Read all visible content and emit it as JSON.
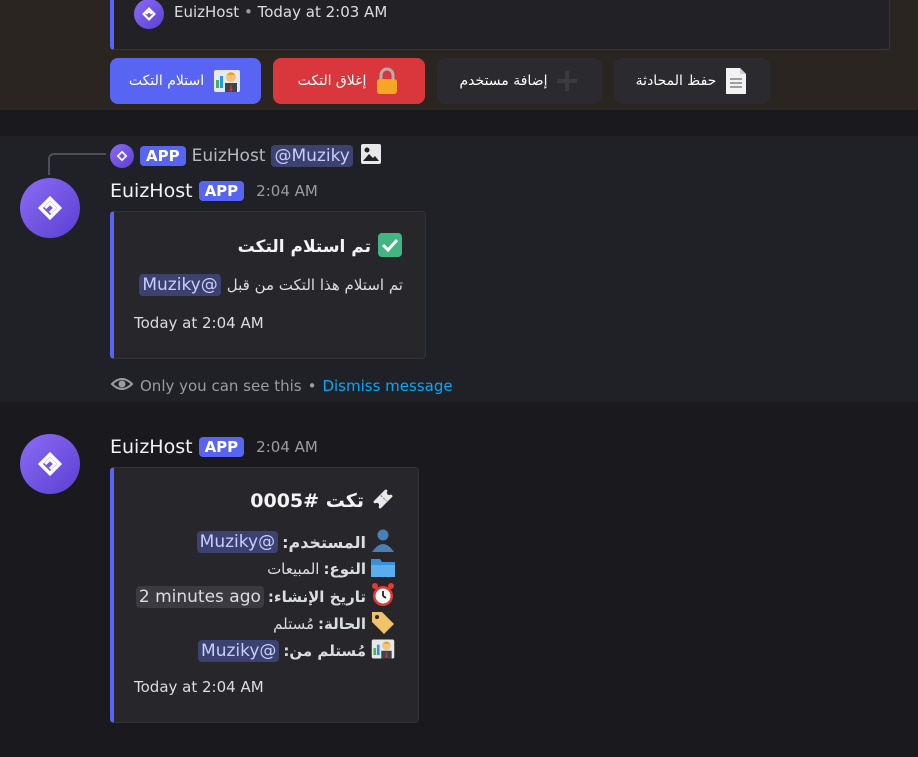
{
  "top": {
    "author": "EuizHost",
    "timestamp": "Today at 2:03 AM",
    "buttons": [
      {
        "label": "استلام التكت",
        "icon": "manager-emoji-icon",
        "color": "#5865f2"
      },
      {
        "label": "إغلاق التكت",
        "icon": "lock-icon",
        "color": "#da373c"
      },
      {
        "label": "إضافة مستخدم",
        "icon": "plus-icon",
        "color": "#2b2a2e"
      },
      {
        "label": "حفظ المحادثة",
        "icon": "document-icon",
        "color": "#2b2a2e"
      }
    ]
  },
  "reply": {
    "author": "EuizHost",
    "badge": "APP",
    "mention": "@Muziky"
  },
  "msg1": {
    "author": "EuizHost",
    "badge": "APP",
    "time": "2:04 AM",
    "embed": {
      "title": "تم استلام التكت",
      "desc": "تم استلام هذا التكت من قبل",
      "mention": "@Muziky",
      "footer": "Today at 2:04 AM"
    },
    "ephemeral_note": "Only you can see this",
    "separator": "•",
    "dismiss": "Dismiss message"
  },
  "msg2": {
    "author": "EuizHost",
    "badge": "APP",
    "time": "2:04 AM",
    "embed": {
      "title": "تكت #0005",
      "user_label": "المستخدم:",
      "user_value": "@Muziky",
      "type_label": "النوع:",
      "type_value": "المبيعات",
      "created_label": "تاريخ الإنشاء:",
      "created_value": "2 minutes ago",
      "status_label": "الحالة:",
      "status_value": "مُستلم",
      "claimed_label": "مُستلم من:",
      "claimed_value": "@Muziky",
      "footer": "Today at 2:04 AM"
    }
  },
  "colors": {
    "accent": "#5865f2",
    "danger": "#da373c",
    "link": "#00a8fc"
  }
}
